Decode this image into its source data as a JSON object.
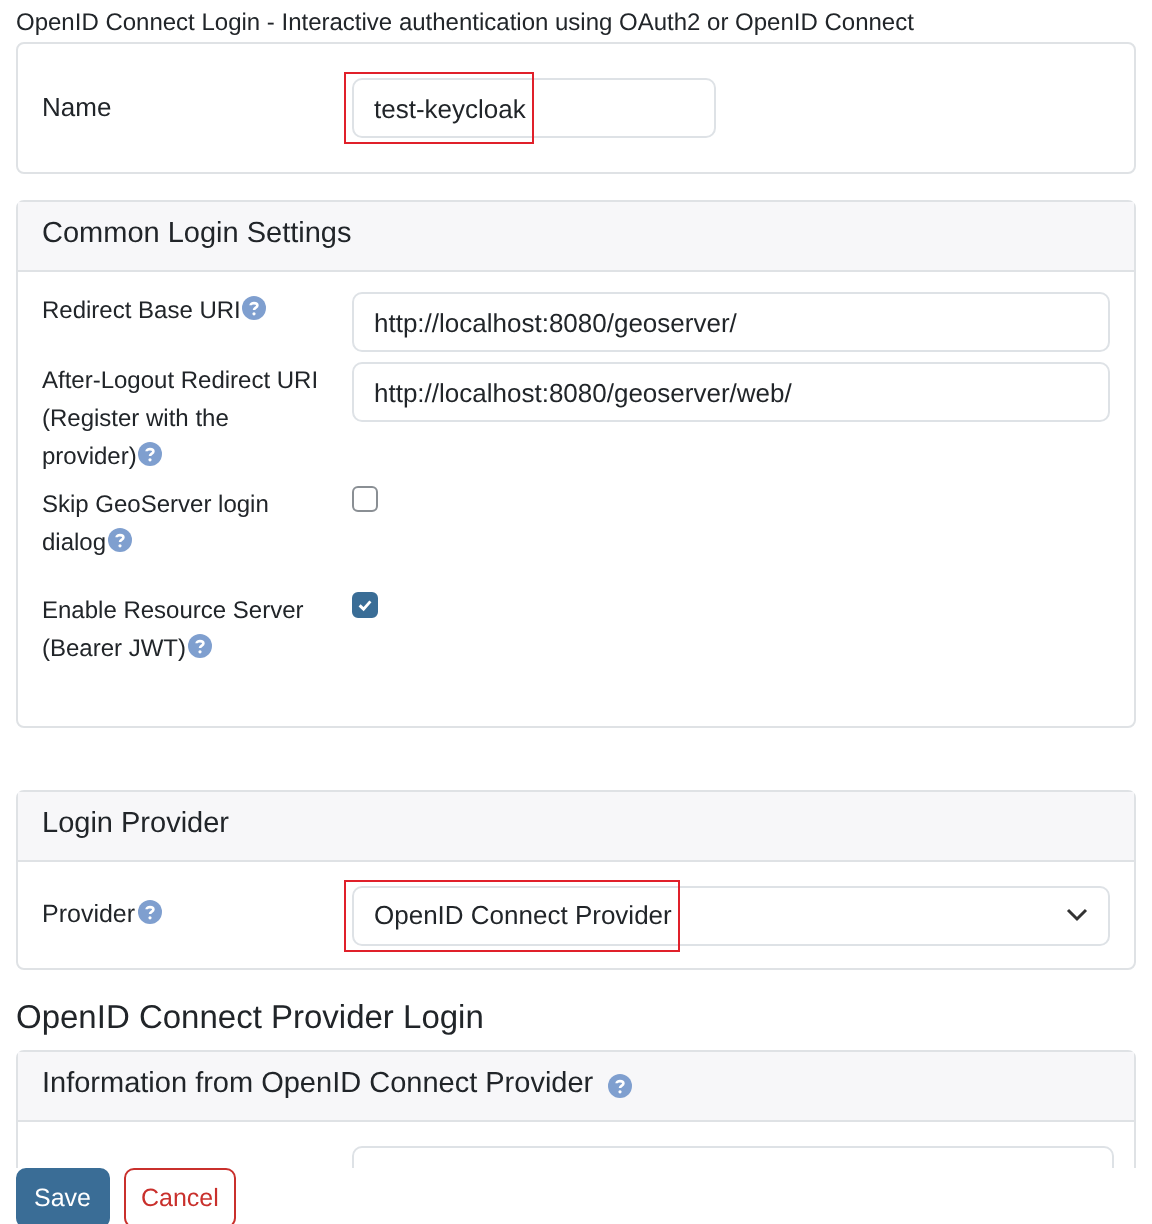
{
  "page_title": "OpenID Connect Login - Interactive authentication using OAuth2 or OpenID Connect",
  "name_panel": {
    "label": "Name",
    "value": "test-keycloak",
    "highlighted": true
  },
  "common_panel": {
    "title": "Common Login Settings",
    "rows": [
      {
        "kind": "text",
        "label": "Redirect Base URI",
        "help": true,
        "value": "http://localhost:8080/geoserver/"
      },
      {
        "kind": "text",
        "label": "After-Logout Redirect URI (Register with the provider)",
        "help": true,
        "value": "http://localhost:8080/geoserver/web/"
      },
      {
        "kind": "checkbox",
        "label": "Skip GeoServer login dialog",
        "help": true,
        "checked": false
      },
      {
        "kind": "checkbox",
        "label": "Enable Resource Server (Bearer JWT)",
        "help": true,
        "checked": true
      }
    ]
  },
  "provider_panel": {
    "title": "Login Provider",
    "label": "Provider",
    "help": true,
    "value": "OpenID Connect Provider",
    "highlighted": true
  },
  "section_heading": "OpenID Connect Provider Login",
  "info_panel": {
    "title": "Information from OpenID Connect Provider",
    "help": true
  },
  "buttons": [
    {
      "kind": "primary",
      "label": "Save"
    },
    {
      "kind": "danger",
      "label": "Cancel"
    }
  ]
}
